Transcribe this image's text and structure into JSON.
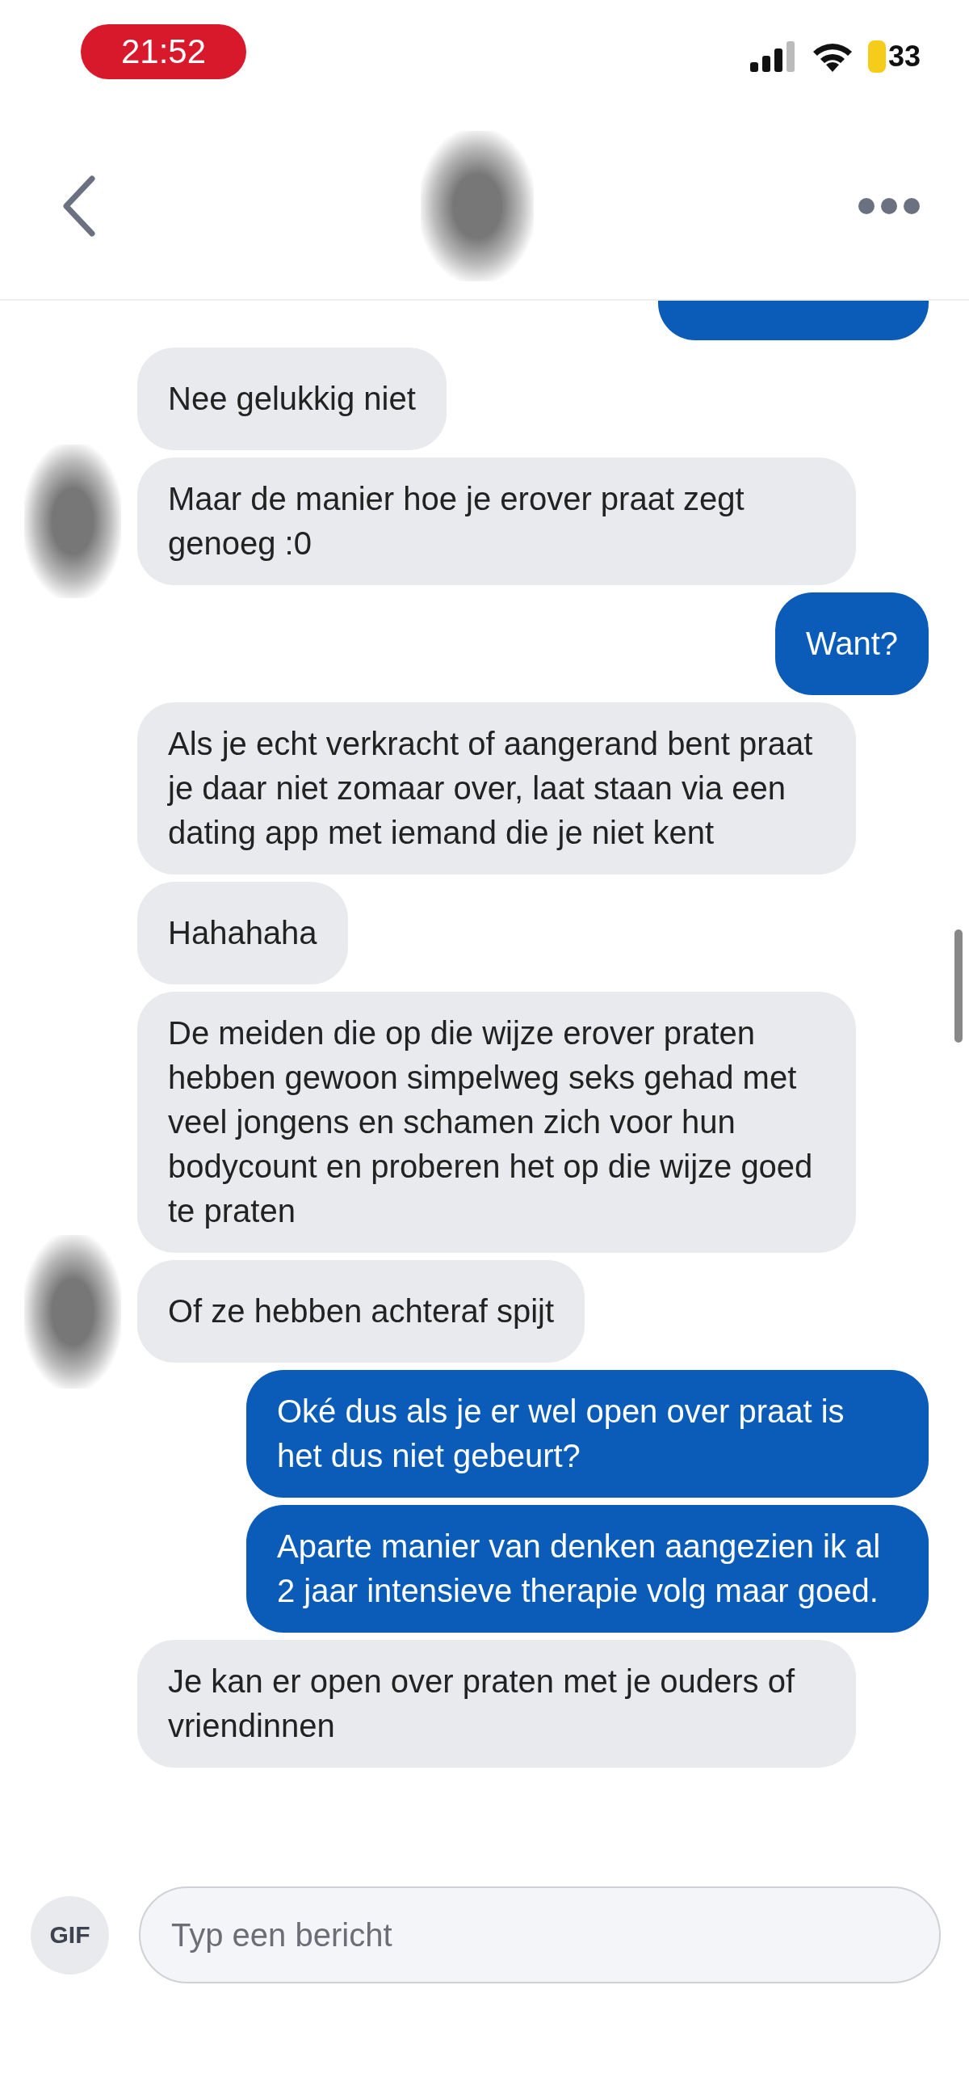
{
  "status_bar": {
    "time": "21:52",
    "battery": "33"
  },
  "messages": [
    {
      "kind": "outgoing",
      "cut": true
    },
    {
      "kind": "incoming",
      "avatar": false,
      "text": "Nee gelukkig niet"
    },
    {
      "kind": "incoming",
      "avatar": true,
      "text": "Maar de manier hoe je erover praat zegt genoeg :0"
    },
    {
      "kind": "outgoing",
      "text": "Want?"
    },
    {
      "kind": "incoming",
      "avatar": false,
      "text": "Als je echt verkracht of aangerand bent praat je daar niet zomaar over, laat staan via een dating app met iemand die je niet kent"
    },
    {
      "kind": "incoming",
      "avatar": false,
      "text": "Hahahaha"
    },
    {
      "kind": "incoming",
      "avatar": false,
      "text": "De meiden die op die wijze erover praten hebben gewoon simpelweg seks gehad met veel jongens en schamen zich voor hun bodycount en proberen het op die wijze goed te praten"
    },
    {
      "kind": "incoming",
      "avatar": true,
      "text": "Of ze hebben achteraf spijt"
    },
    {
      "kind": "outgoing",
      "text": "Oké dus als je er wel open over praat is het dus niet gebeurt?"
    },
    {
      "kind": "outgoing",
      "text": "Aparte manier van denken aangezien ik al 2 jaar intensieve therapie volg maar goed."
    },
    {
      "kind": "incoming",
      "avatar": false,
      "text": "Je kan er open over praten met je ouders of vriendinnen"
    }
  ],
  "composer": {
    "gif": "GIF",
    "placeholder": "Typ een bericht"
  }
}
